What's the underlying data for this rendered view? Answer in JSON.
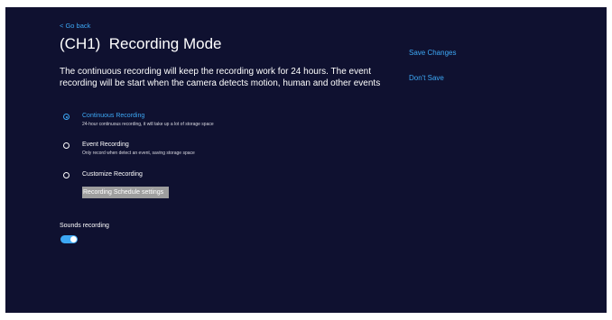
{
  "nav": {
    "back_label": "< Go back"
  },
  "page": {
    "title": "(CH1)  Recording Mode",
    "description": "The continuous recording will keep the recording work for 24 hours. The event recording will be start when the camera detects motion, human and other events"
  },
  "options": [
    {
      "label": "Continuous Recording",
      "sub": "24-hour continuous recording, it will take up a lot of storage space",
      "selected": true
    },
    {
      "label": "Event Recording",
      "sub": "Only record when detect an event, saving storage space",
      "selected": false
    },
    {
      "label": "Customize Recording",
      "sub": "",
      "selected": false
    }
  ],
  "schedule": {
    "label": "Recording Schedule settings"
  },
  "sounds": {
    "label": "Sounds recording",
    "enabled": true
  },
  "actions": {
    "save": "Save Changes",
    "dont_save": "Don't Save"
  },
  "colors": {
    "background": "#0f1130",
    "accent": "#3da8f5",
    "text": "#ffffff"
  }
}
